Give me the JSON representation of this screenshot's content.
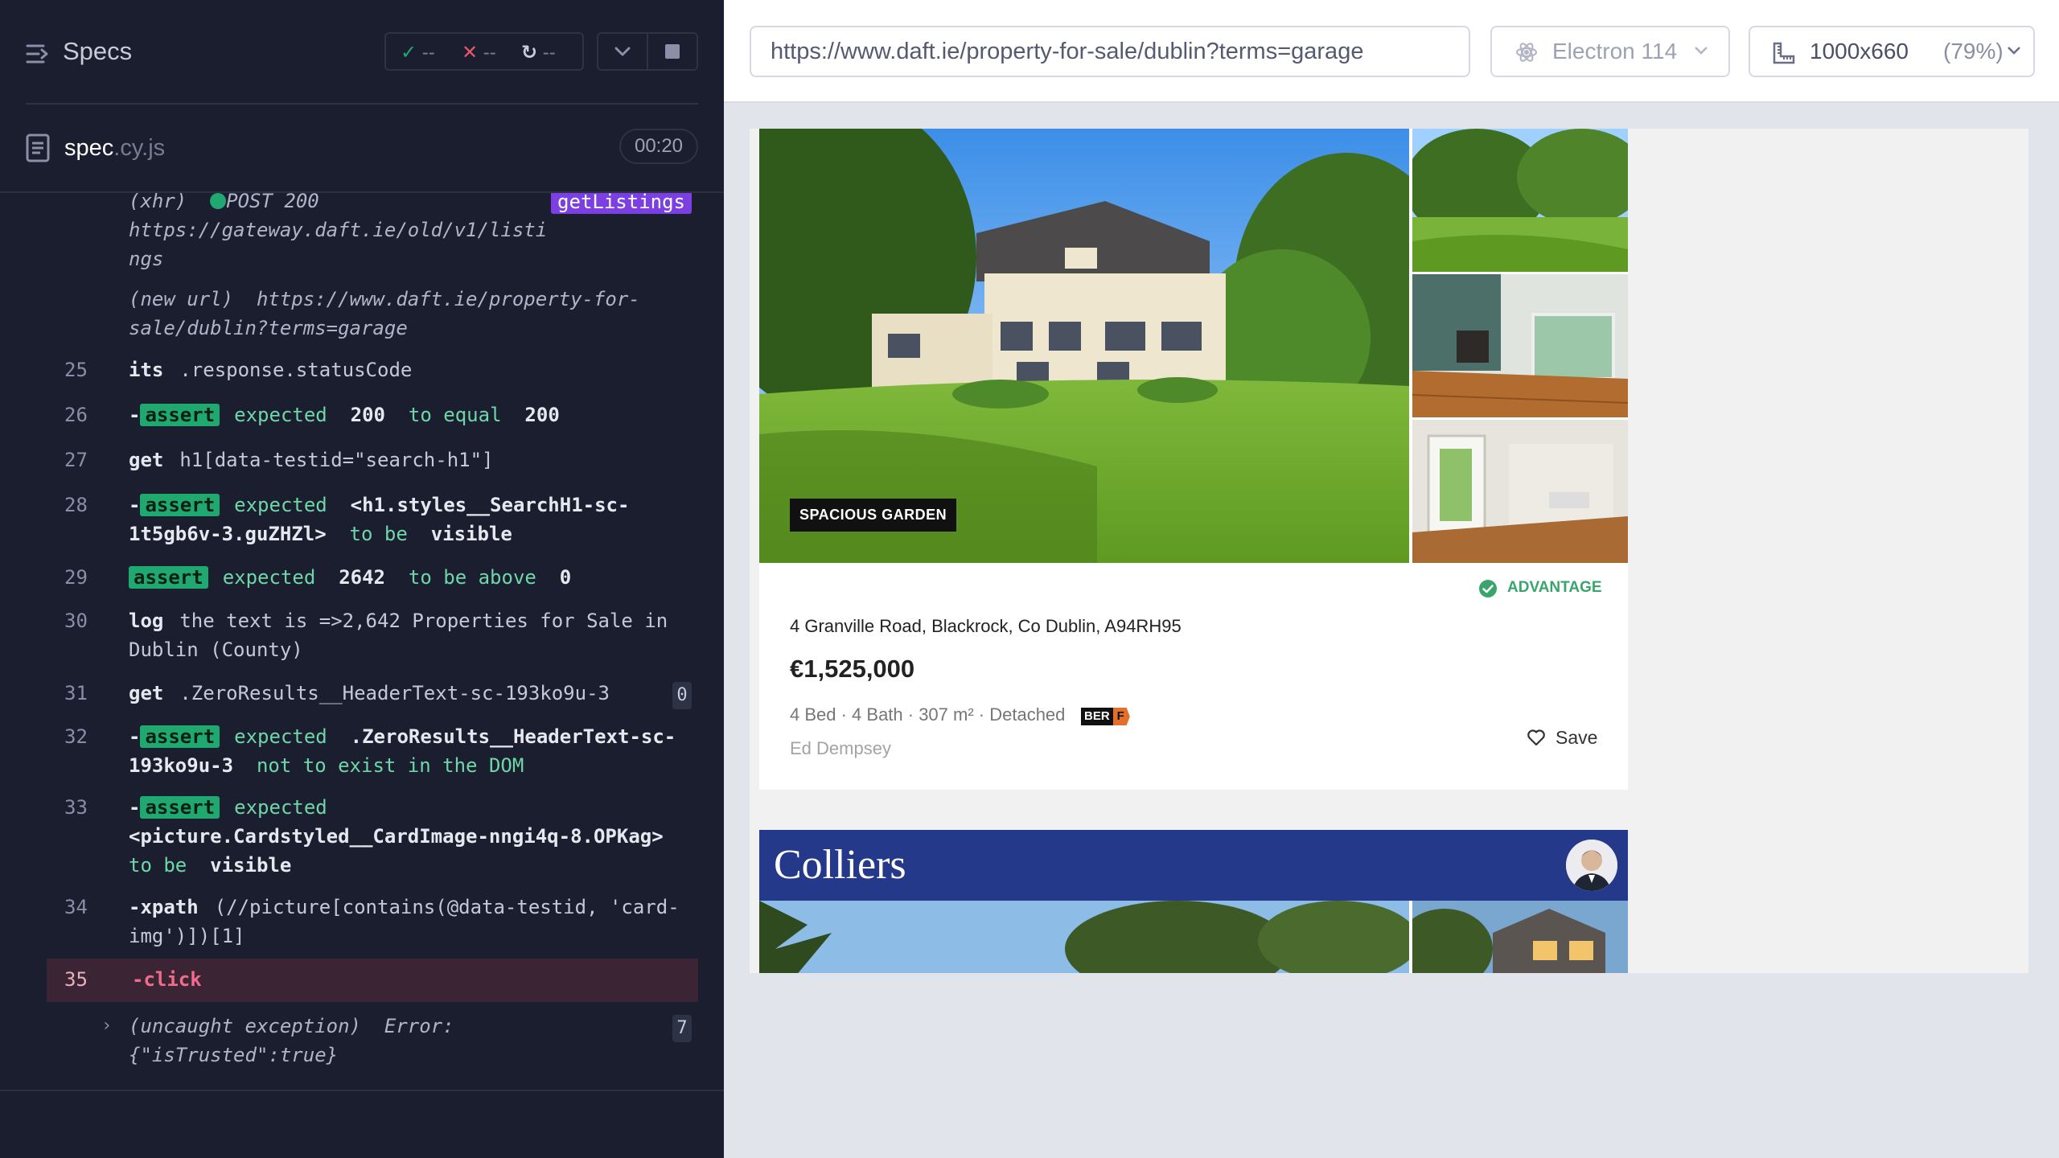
{
  "left": {
    "title": "Specs",
    "stats": {
      "passed": "--",
      "failed": "--",
      "pending": "--"
    },
    "spec": {
      "name": "spec",
      "ext": ".cy.js",
      "duration": "00:20"
    },
    "commands": [
      {
        "num": "",
        "type": "xhr",
        "line1_a": "(xhr)",
        "line1_b": "POST 200",
        "line2": "https://gateway.daft.ie/old/v1/listi",
        "line3": "ngs",
        "badge": "getListings"
      },
      {
        "num": "",
        "type": "newurl",
        "line1_a": "(new url)",
        "line1_b": "https://www.daft.ie/property-for-",
        "line2": "sale/dublin?terms=garage"
      },
      {
        "num": "25",
        "name": "its",
        "message": ".response.statusCode"
      },
      {
        "num": "26",
        "name": "-assert",
        "p1": "expected",
        "p2": "200",
        "p3": "to equal",
        "p4": "200"
      },
      {
        "num": "27",
        "name": "get",
        "message": "h1[data-testid=\"search-h1\"]"
      },
      {
        "num": "28",
        "name": "-assert",
        "p1": "expected",
        "p2": "<h1.styles__SearchH1-sc-",
        "p3": "1t5gb6v-3.guZHZl>",
        "p4": "to be",
        "p5": "visible"
      },
      {
        "num": "29",
        "name": "assert",
        "p1": "expected",
        "p2": "2642",
        "p3": "to be above",
        "p4": "0"
      },
      {
        "num": "30",
        "name": "log",
        "line1": "the text is =>2,642 Properties for Sale in",
        "line2": "Dublin (County)"
      },
      {
        "num": "31",
        "name": "get",
        "message": ".ZeroResults__HeaderText-sc-193ko9u-3",
        "count": "0"
      },
      {
        "num": "32",
        "name": "-assert",
        "p1": "expected",
        "p2": ".ZeroResults__HeaderText-sc-",
        "p3": "193ko9u-3",
        "p4": "not to exist in the DOM"
      },
      {
        "num": "33",
        "name": "-assert",
        "p1": "expected",
        "p2": "<picture.Cardstyled__CardImage-nngi4q-8.OPKag>",
        "p3": "to be",
        "p4": "visible"
      },
      {
        "num": "34",
        "name": "-xpath",
        "line1": "(//picture[contains(@data-testid, 'card-",
        "line2": "img')])[1]"
      },
      {
        "num": "35",
        "name": "-click"
      },
      {
        "num": "",
        "type": "exception",
        "line1_a": "(uncaught exception)",
        "line1_b": "Error:",
        "line2": "{\"isTrusted\":true}",
        "count": "7"
      }
    ]
  },
  "right": {
    "url": "https://www.daft.ie/property-for-sale/dublin?terms=garage",
    "browser": "Electron 114",
    "viewport": "1000x660",
    "zoom": "(79%)",
    "listing": {
      "photo_tag": "SPACIOUS GARDEN",
      "badge": "ADVANTAGE",
      "address": "4 Granville Road, Blackrock, Co Dublin, A94RH95",
      "price": "€1,525,000",
      "meta": "4 Bed · 4 Bath · 307 m² · Detached",
      "ber_label": "BER",
      "ber_rating": "F",
      "agent": "Ed Dempsey",
      "save_label": "Save"
    },
    "listing2": {
      "agency": "Colliers"
    }
  },
  "colors": {
    "panel_bg": "#1b1e2e",
    "assert_green": "#1fa971",
    "route_purple": "#7b3fe4",
    "fail_red": "#e45770",
    "advantage_green": "#3aa56b",
    "colliers_blue": "#25398b"
  }
}
